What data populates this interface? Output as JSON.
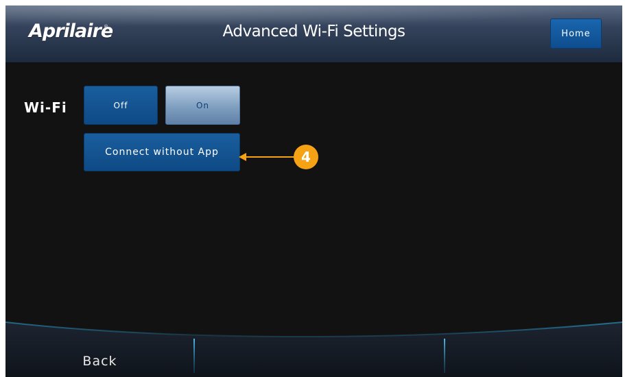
{
  "header": {
    "brand": "Aprilaire",
    "brand_mark": "®",
    "title": "Advanced Wi-Fi Settings",
    "home_label": "Home"
  },
  "wifi": {
    "label": "Wi-Fi",
    "off_label": "Off",
    "on_label": "On",
    "selected": "On"
  },
  "connect": {
    "label": "Connect without App"
  },
  "callout": {
    "number": "4",
    "color": "#f5a214"
  },
  "footer": {
    "back_label": "Back"
  },
  "colors": {
    "button_blue": "#0e4a85",
    "selected_button": "#7f9fc0",
    "background": "#121212",
    "accent_line": "#2aa6d8"
  }
}
